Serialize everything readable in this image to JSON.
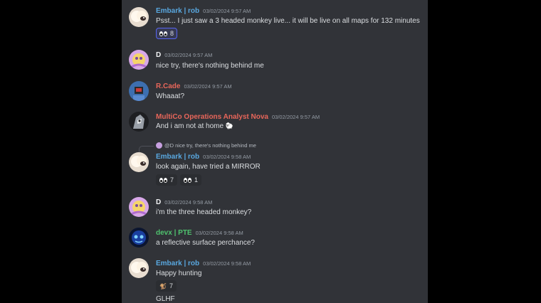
{
  "messages": [
    {
      "author": "Embark | rob",
      "timestamp": "03/02/2024 9:57 AM",
      "text": "Psst... I just saw a 3 headed monkey live... it will be live on all maps for 132 minutes",
      "reactions": [
        {
          "icon": "eyes-icon",
          "count": "8"
        }
      ]
    },
    {
      "author": "D",
      "timestamp": "03/02/2024 9:57 AM",
      "text": "nice try, there's nothing behind me"
    },
    {
      "author": "R.Cade",
      "timestamp": "03/02/2024 9:57 AM",
      "text": "Whaaat?"
    },
    {
      "author": "MultiCo Operations Analyst Nova",
      "timestamp": "03/02/2024 9:57 AM",
      "text": "And i am not at home"
    },
    {
      "reply": "@D nice try, there's nothing behind me",
      "author": "Embark | rob",
      "timestamp": "03/02/2024 9:58 AM",
      "text": "look again, have tried a MIRROR",
      "reactions": [
        {
          "icon": "eyes-sideways-icon",
          "count": "7"
        },
        {
          "icon": "eyes-icon",
          "count": "1"
        }
      ]
    },
    {
      "author": "D",
      "timestamp": "03/02/2024 9:58 AM",
      "text": "i'm the three headed monkey?"
    },
    {
      "author": "devx | PTE",
      "timestamp": "03/02/2024 9:58 AM",
      "text": "a reflective surface perchance?"
    },
    {
      "author": "Embark | rob",
      "timestamp": "03/02/2024 9:58 AM",
      "text": "Happy hunting",
      "reactions": [
        {
          "icon": "monkey-icon",
          "count": "7"
        }
      ]
    },
    {
      "text": "GLHF"
    }
  ],
  "colors": {
    "embark": "#59a8e0",
    "default": "#f2f3f5",
    "red": "#e8665a",
    "green": "#4fc26e",
    "background": "#313338"
  }
}
